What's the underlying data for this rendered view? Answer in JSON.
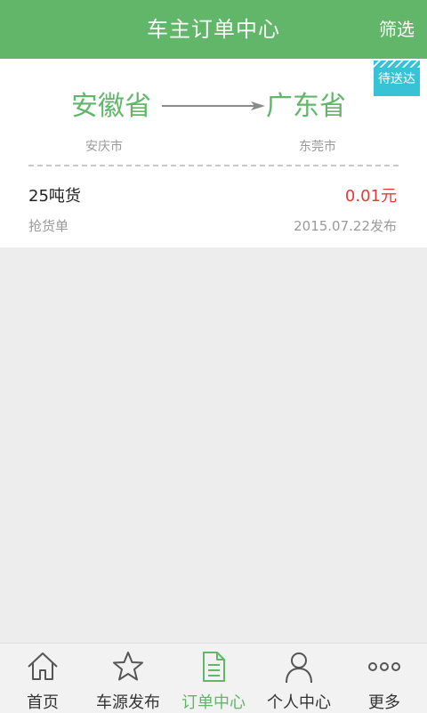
{
  "header": {
    "title": "车主订单中心",
    "filter_label": "筛选"
  },
  "order": {
    "status_badge": "待送达",
    "from_province": "安徽省",
    "to_province": "广东省",
    "from_city": "安庆市",
    "to_city": "东莞市",
    "cargo": "25吨货",
    "price": "0.01元",
    "type": "抢货单",
    "published": "2015.07.22发布"
  },
  "tabs": [
    {
      "label": "首页",
      "icon": "home-icon",
      "active": false
    },
    {
      "label": "车源发布",
      "icon": "star-icon",
      "active": false
    },
    {
      "label": "订单中心",
      "icon": "document-icon",
      "active": true
    },
    {
      "label": "个人中心",
      "icon": "person-icon",
      "active": false
    },
    {
      "label": "更多",
      "icon": "more-icon",
      "active": false
    }
  ],
  "colors": {
    "primary_green": "#62b66a",
    "badge_blue": "#38c2d6",
    "price_red": "#e23c36",
    "background": "#ededed"
  }
}
